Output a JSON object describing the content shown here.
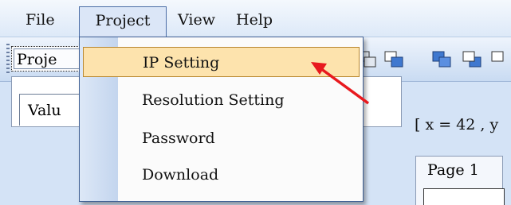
{
  "menubar": {
    "file": "File",
    "project": "Project",
    "view": "View",
    "help": "Help"
  },
  "toolbar": {
    "icons": [
      "new-project-icon",
      "open-folder-icon",
      "layer-icon",
      "layer-icon",
      "layer-icon",
      "layer-icon"
    ]
  },
  "project_menu": {
    "items": [
      "IP Setting",
      "Resolution Setting",
      "Password",
      "Download"
    ],
    "highlighted": "IP Setting"
  },
  "workspace": {
    "project_tab": "Proje",
    "value_label": "Valu",
    "coords": "[ x = 42 , y",
    "page_tab": "Page 1"
  },
  "colors": {
    "highlight": "#fde3ad",
    "arrow": "#e8191e",
    "menu_border": "#3f5f94"
  }
}
